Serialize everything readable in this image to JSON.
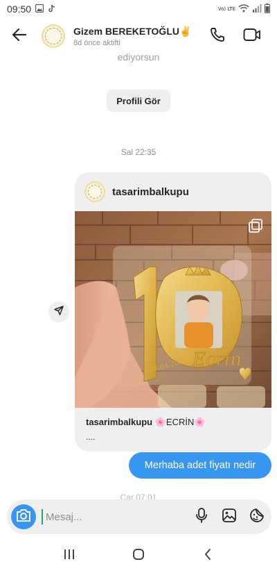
{
  "status_bar": {
    "time": "09:50",
    "network_label": "Vo) LTE",
    "icons": [
      "image-icon",
      "tiktok-icon",
      "wifi-icon",
      "signal-icon",
      "battery-icon"
    ]
  },
  "header": {
    "contact_name": "Gizem BEREKETOĞLU✌️",
    "contact_status": "8d önce aktifti",
    "icons": [
      "back-arrow-icon",
      "phone-icon",
      "video-camera-icon"
    ]
  },
  "chat": {
    "scrolled_text": "ediyorsun",
    "profile_button_label": "Profili Gör",
    "timestamp_1": "Sal 22:35",
    "shared_post": {
      "username": "tasarimbalkupu",
      "caption_user": "tasarimbalkupu",
      "caption_text": " 🌸ECRİN🌸",
      "more": "....",
      "image_text_name": "Ecrin",
      "image_text_date": "26.04.2021"
    },
    "sent_message": "Merhaba adet fiyatı nedir",
    "timestamp_2": "Çar 07:01"
  },
  "composer": {
    "placeholder": "Mesaj...",
    "icons": [
      "camera-icon",
      "microphone-icon",
      "gallery-icon",
      "sticker-icon"
    ]
  },
  "colors": {
    "accent": "#3797f0",
    "bubble_received": "#efefef",
    "text_secondary": "#8e8e8e"
  }
}
